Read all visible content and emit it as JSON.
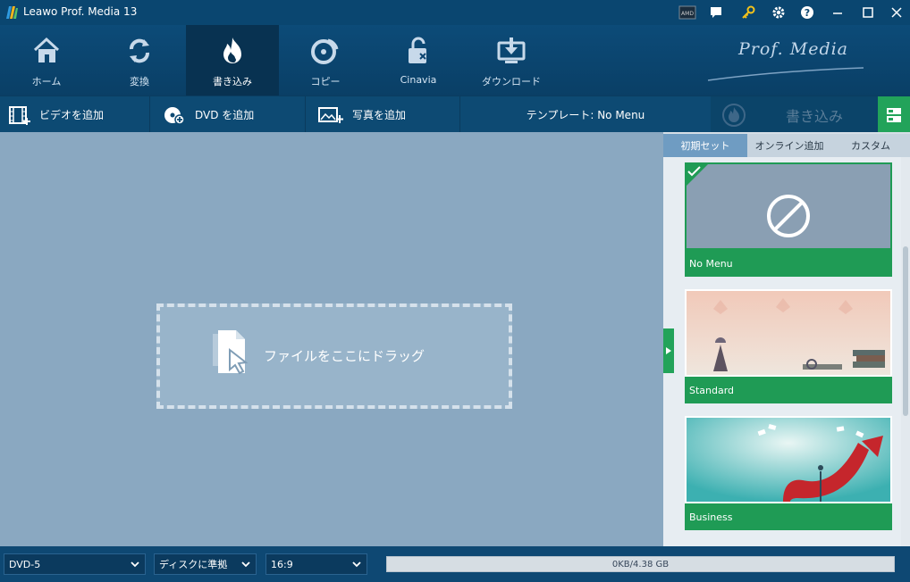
{
  "window": {
    "title": "Leawo Prof. Media 13"
  },
  "titlebar_icons": [
    "amd-icon",
    "chat-icon",
    "key-icon",
    "gear-icon",
    "help-icon",
    "minimize-icon",
    "maximize-icon",
    "close-icon"
  ],
  "nav": {
    "items": [
      {
        "label": "ホーム",
        "icon": "home-icon"
      },
      {
        "label": "変換",
        "icon": "convert-icon"
      },
      {
        "label": "書き込み",
        "icon": "fire-icon",
        "active": true
      },
      {
        "label": "コピー",
        "icon": "disc-copy-icon"
      },
      {
        "label": "Cinavia",
        "icon": "unlock-icon"
      },
      {
        "label": "ダウンロード",
        "icon": "download-icon"
      }
    ],
    "brand": "Prof. Media"
  },
  "toolbar": {
    "add_video": "ビデオを追加",
    "add_dvd": "DVD を追加",
    "add_photo": "写真を追加",
    "template": "テンプレート: No Menu",
    "burn": "書き込み"
  },
  "main": {
    "drop_text": "ファイルをここにドラッグ"
  },
  "panel": {
    "tabs": [
      "初期セット",
      "オンライン追加",
      "カスタム"
    ],
    "active_tab": 0,
    "templates": [
      {
        "label": "No Menu",
        "selected": true
      },
      {
        "label": "Standard"
      },
      {
        "label": "Business"
      }
    ]
  },
  "status": {
    "disc_type": "DVD-5",
    "quality": "ディスクに準拠",
    "aspect": "16:9",
    "storage": "0KB/4.38 GB"
  },
  "colors": {
    "accent_green": "#1f9b55",
    "nav_bg": "#0c4b78",
    "main_bg": "#8aa8c1"
  }
}
